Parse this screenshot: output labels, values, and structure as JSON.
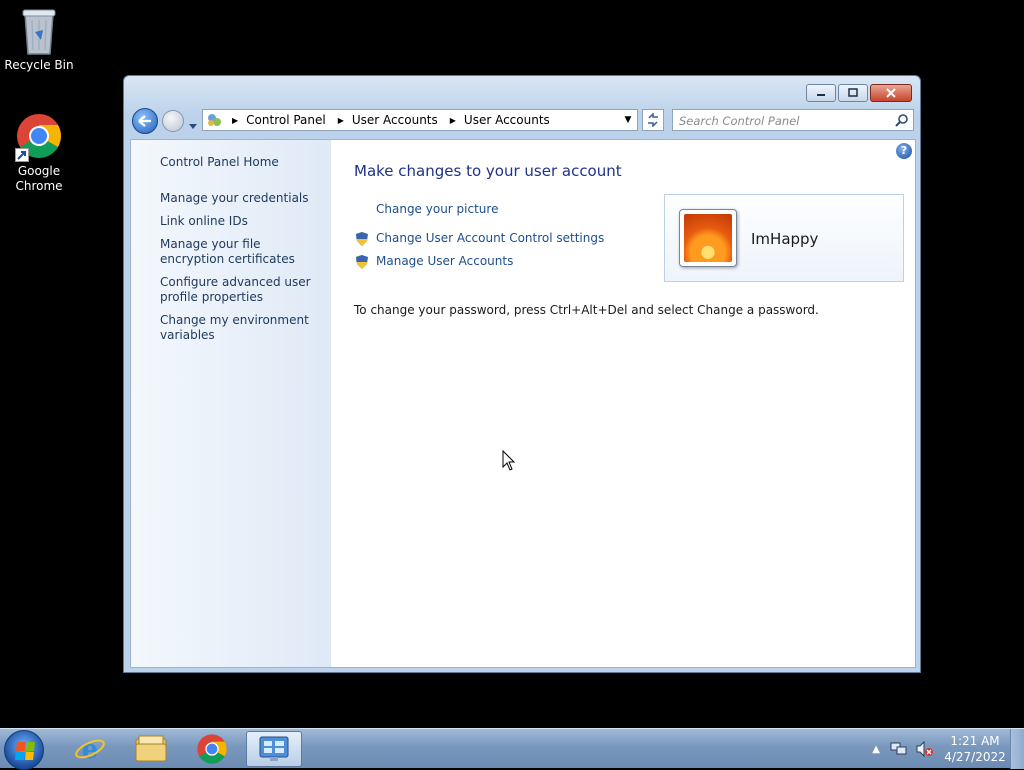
{
  "desktop": {
    "icons": [
      {
        "label": "Recycle Bin"
      },
      {
        "label": "Google Chrome"
      }
    ]
  },
  "window": {
    "breadcrumb": [
      "Control Panel",
      "User Accounts",
      "User Accounts"
    ],
    "search_placeholder": "Search Control Panel",
    "left_nav": [
      "Control Panel Home",
      "Manage your credentials",
      "Link online IDs",
      "Manage your file encryption certificates",
      "Configure advanced user profile properties",
      "Change my environment variables"
    ],
    "main": {
      "heading": "Make changes to your user account",
      "tasks": [
        {
          "label": "Change your picture",
          "shield": false
        },
        {
          "label": "Change User Account Control settings",
          "shield": true
        },
        {
          "label": "Manage User Accounts",
          "shield": true
        }
      ],
      "password_note": "To change your password, press Ctrl+Alt+Del and select Change a password.",
      "user_name": "ImHappy"
    }
  },
  "taskbar": {
    "clock_time": "1:21 AM",
    "clock_date": "4/27/2022"
  }
}
